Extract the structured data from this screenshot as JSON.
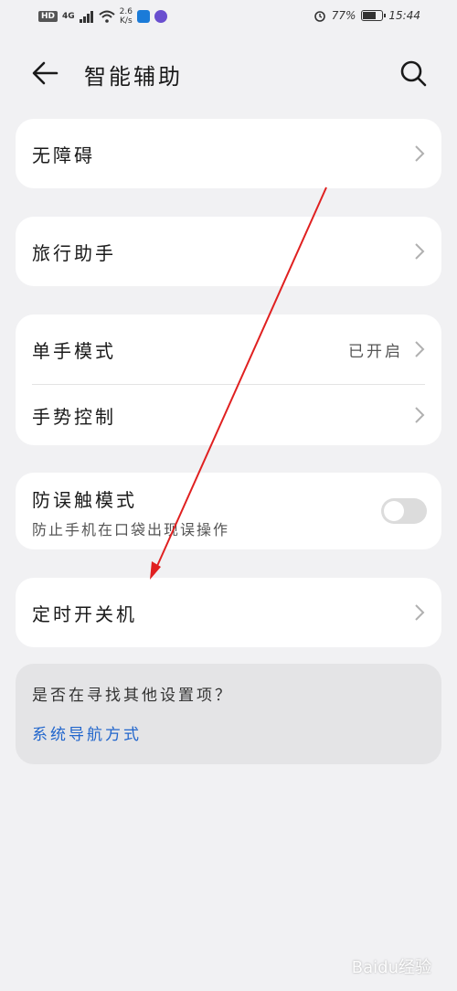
{
  "status_bar": {
    "hd": "HD",
    "network": "4G",
    "speed_value": "2.6",
    "speed_unit": "K/s",
    "battery_percent": "77%",
    "battery_level": 0.77,
    "time": "15:44"
  },
  "header": {
    "title": "智能辅助"
  },
  "cards": {
    "accessibility": {
      "label": "无障碍"
    },
    "travel": {
      "label": "旅行助手"
    },
    "one_hand": {
      "label": "单手模式",
      "value": "已开启"
    },
    "gesture": {
      "label": "手势控制"
    },
    "anti_touch": {
      "label": "防误触模式",
      "sub": "防止手机在口袋出现误操作",
      "enabled": false
    },
    "timer_power": {
      "label": "定时开关机"
    }
  },
  "hint": {
    "question": "是否在寻找其他设置项？",
    "link": "系统导航方式"
  },
  "watermark": "Baidu经验",
  "colors": {
    "background": "#f1f1f3",
    "card": "#ffffff",
    "link": "#2266cc",
    "annotation_arrow": "#e02020"
  }
}
